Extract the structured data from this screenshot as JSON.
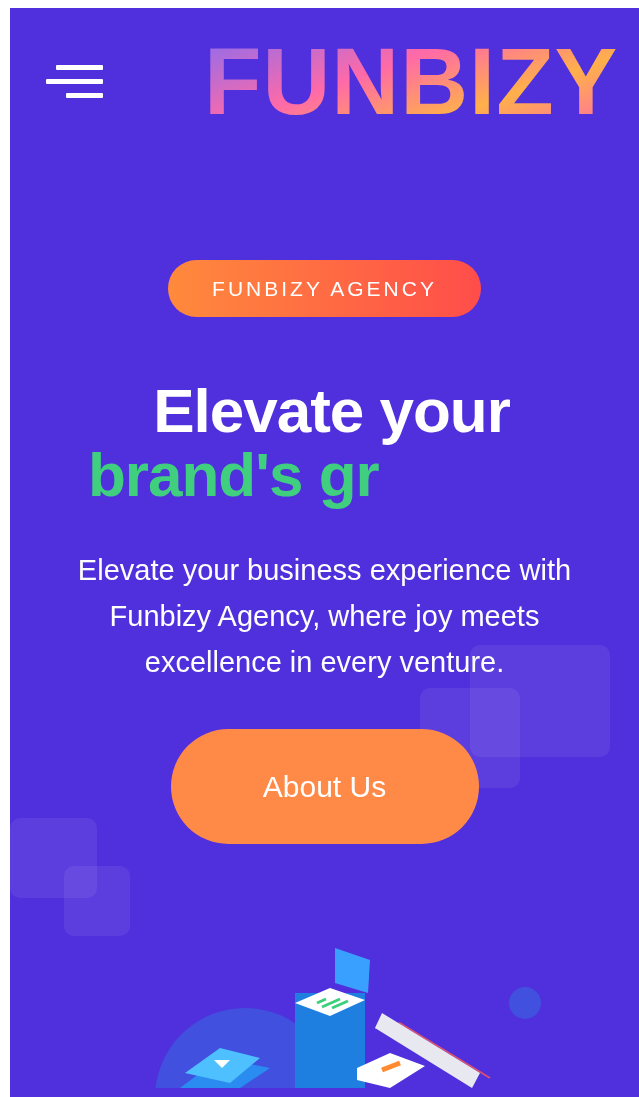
{
  "header": {
    "logo": "FUNBIZY"
  },
  "hero": {
    "badge": "FUNBIZY AGENCY",
    "headline": "Elevate your",
    "headline_typed": "brand's gr",
    "description": "Elevate your business experience with Funbizy Agency, where joy meets excellence in every venture.",
    "button": "About Us"
  }
}
